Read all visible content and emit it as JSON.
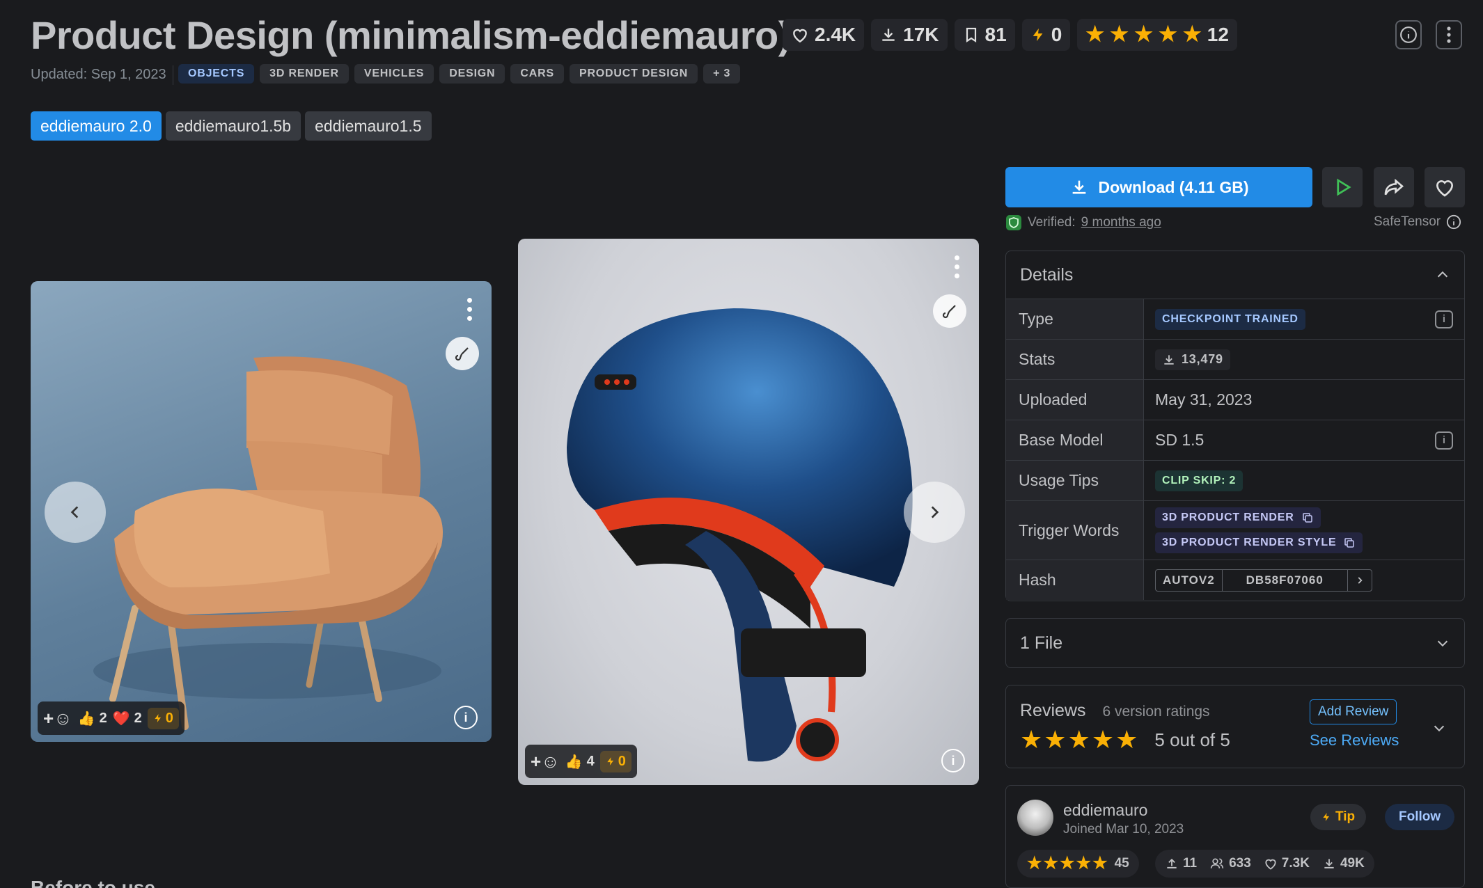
{
  "header": {
    "title": "Product Design (minimalism-eddiemauro)",
    "stats": {
      "likes": "2.4K",
      "downloads": "17K",
      "bookmarks": "81",
      "buzz": "0",
      "rating_count": "12"
    },
    "updated": "Updated: Sep 1, 2023",
    "tags": [
      "OBJECTS",
      "3D RENDER",
      "VEHICLES",
      "DESIGN",
      "CARS",
      "PRODUCT DESIGN",
      "+ 3"
    ]
  },
  "versions": [
    "eddiemauro 2.0",
    "eddiemauro1.5b",
    "eddiemauro1.5"
  ],
  "gallery": {
    "card1": {
      "thumbs": "2",
      "hearts": "2",
      "buzz": "0"
    },
    "card2": {
      "thumbs": "4",
      "buzz": "0"
    }
  },
  "download": {
    "label": "Download (4.11 GB)",
    "verified_label": "Verified:",
    "verified_time": "9 months ago",
    "format": "SafeTensor"
  },
  "details": {
    "title": "Details",
    "rows": {
      "type_label": "Type",
      "type_value": "CHECKPOINT TRAINED",
      "stats_label": "Stats",
      "stats_value": "13,479",
      "uploaded_label": "Uploaded",
      "uploaded_value": "May 31, 2023",
      "base_label": "Base Model",
      "base_value": "SD 1.5",
      "tips_label": "Usage Tips",
      "tips_value": "CLIP SKIP: 2",
      "trigger_label": "Trigger Words",
      "trigger_1": "3D PRODUCT RENDER",
      "trigger_2": "3D PRODUCT RENDER STYLE",
      "hash_label": "Hash",
      "hash_type": "AUTOV2",
      "hash_value": "DB58F07060"
    }
  },
  "files": {
    "label": "1 File"
  },
  "reviews": {
    "title": "Reviews",
    "count": "6 version ratings",
    "rating_text": "5 out of 5",
    "add_label": "Add Review",
    "see_label": "See Reviews"
  },
  "author": {
    "name": "eddiemauro",
    "joined": "Joined Mar 10, 2023",
    "tip_label": "Tip",
    "follow_label": "Follow",
    "rating_count": "45",
    "uploads": "11",
    "followers": "633",
    "likes": "7.3K",
    "downloads": "49K"
  },
  "section_below": "Before to use",
  "colors": {
    "accent": "#228be6",
    "star": "#fab005",
    "background": "#1a1b1e"
  }
}
